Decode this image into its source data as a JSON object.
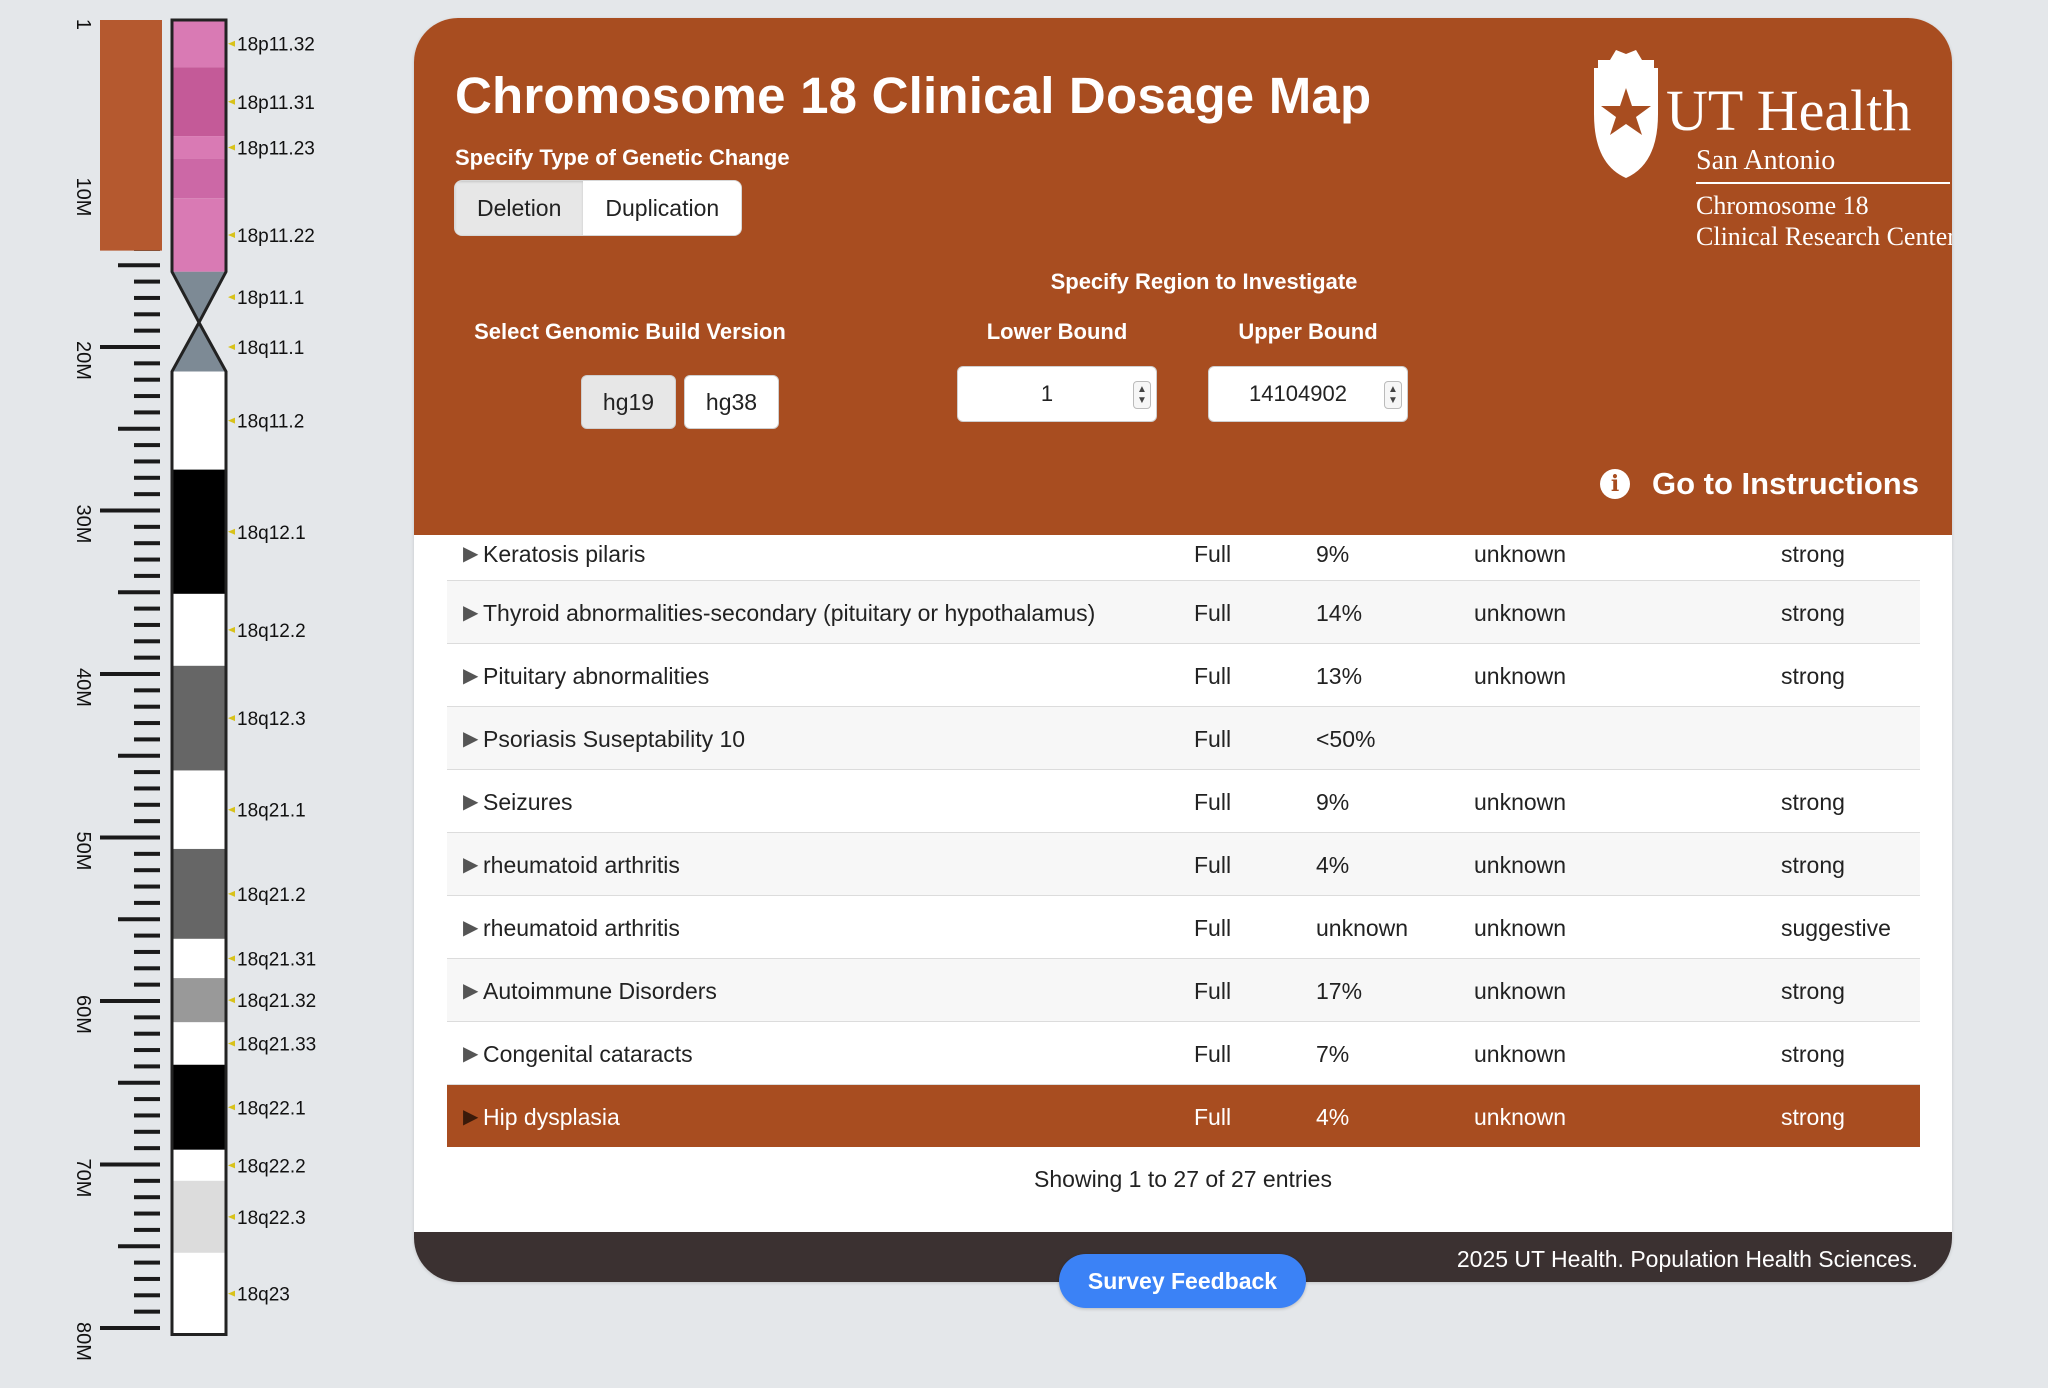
{
  "ideogram": {
    "scale_labels": [
      "1",
      "10M",
      "20M",
      "30M",
      "40M",
      "50M",
      "60M",
      "70M",
      "80M"
    ],
    "bands": [
      {
        "name": "18p11.32",
        "start": 0,
        "end": 2.9,
        "fill": "#d97ab4"
      },
      {
        "name": "18p11.31",
        "start": 2.9,
        "end": 7.1,
        "fill": "#c45a98"
      },
      {
        "name": "18p11.23",
        "start": 7.1,
        "end": 8.5,
        "fill": "#d97ab4"
      },
      {
        "name": "",
        "start": 8.5,
        "end": 10.9,
        "fill": "#cc68a6"
      },
      {
        "name": "18p11.22",
        "start": 10.9,
        "end": 15.4,
        "fill": "#d97ab4"
      },
      {
        "name": "18p11.1",
        "start": 15.4,
        "end": 18.5,
        "fill": "#7d8a95"
      },
      {
        "name": "18q11.1",
        "start": 18.5,
        "end": 21.5,
        "fill": "#7d8a95"
      },
      {
        "name": "18q11.2",
        "start": 21.5,
        "end": 27.5,
        "fill": "#ffffff"
      },
      {
        "name": "18q12.1",
        "start": 27.5,
        "end": 35.1,
        "fill": "#000000"
      },
      {
        "name": "18q12.2",
        "start": 35.1,
        "end": 39.5,
        "fill": "#ffffff"
      },
      {
        "name": "18q12.3",
        "start": 39.5,
        "end": 45.9,
        "fill": "#666666"
      },
      {
        "name": "18q21.1",
        "start": 45.9,
        "end": 50.7,
        "fill": "#ffffff"
      },
      {
        "name": "18q21.2",
        "start": 50.7,
        "end": 56.2,
        "fill": "#666666"
      },
      {
        "name": "18q21.31",
        "start": 56.2,
        "end": 58.6,
        "fill": "#ffffff"
      },
      {
        "name": "18q21.32",
        "start": 58.6,
        "end": 61.3,
        "fill": "#999999"
      },
      {
        "name": "18q21.33",
        "start": 61.3,
        "end": 63.9,
        "fill": "#ffffff"
      },
      {
        "name": "18q22.1",
        "start": 63.9,
        "end": 69.1,
        "fill": "#000000"
      },
      {
        "name": "18q22.2",
        "start": 69.1,
        "end": 71.0,
        "fill": "#ffffff"
      },
      {
        "name": "18q22.3",
        "start": 71.0,
        "end": 75.4,
        "fill": "#dcdcdc"
      },
      {
        "name": "18q23",
        "start": 75.4,
        "end": 80.4,
        "fill": "#ffffff"
      }
    ],
    "selection": {
      "start": 1,
      "end": 14104902
    },
    "colors": {
      "selection": "#b5592f",
      "marker": "#d8c21a"
    }
  },
  "header": {
    "title": "Chromosome 18 Clinical Dosage Map",
    "change_label": "Specify Type of Genetic Change",
    "deletion_label": "Deletion",
    "duplication_label": "Duplication",
    "region_label": "Specify Region to Investigate",
    "build_label": "Select Genomic Build Version",
    "hg19_label": "hg19",
    "hg38_label": "hg38",
    "lower_label": "Lower Bound",
    "upper_label": "Upper Bound",
    "lower_value": "1",
    "upper_value": "14104902",
    "instructions_label": "Go to Instructions",
    "logo": {
      "line1": "UT Health",
      "line2": "San Antonio",
      "line3": "Chromosome 18",
      "line4": "Clinical Research Center"
    }
  },
  "table": {
    "rows": [
      {
        "name": "Keratosis pilaris",
        "type": "Full",
        "pct": "9%",
        "col4": "unknown",
        "col5": "strong"
      },
      {
        "name": "Thyroid abnormalities-secondary (pituitary or hypothalamus)",
        "type": "Full",
        "pct": "14%",
        "col4": "unknown",
        "col5": "strong"
      },
      {
        "name": "Pituitary abnormalities",
        "type": "Full",
        "pct": "13%",
        "col4": "unknown",
        "col5": "strong"
      },
      {
        "name": "Psoriasis Suseptability 10",
        "type": "Full",
        "pct": "<50%",
        "col4": "",
        "col5": ""
      },
      {
        "name": "Seizures",
        "type": "Full",
        "pct": "9%",
        "col4": "unknown",
        "col5": "strong"
      },
      {
        "name": "rheumatoid arthritis",
        "type": "Full",
        "pct": "4%",
        "col4": "unknown",
        "col5": "strong"
      },
      {
        "name": "rheumatoid arthritis",
        "type": "Full",
        "pct": "unknown",
        "col4": "unknown",
        "col5": "suggestive"
      },
      {
        "name": "Autoimmune Disorders",
        "type": "Full",
        "pct": "17%",
        "col4": "unknown",
        "col5": "strong"
      },
      {
        "name": "Congenital cataracts",
        "type": "Full",
        "pct": "7%",
        "col4": "unknown",
        "col5": "strong"
      },
      {
        "name": "Hip dysplasia",
        "type": "Full",
        "pct": "4%",
        "col4": "unknown",
        "col5": "strong"
      }
    ],
    "arrow": "▶",
    "entries_text": "Showing 1 to 27 of 27 entries"
  },
  "footer": {
    "copyright": "2025 UT Health. Population Health Sciences.",
    "survey_label": "Survey Feedback"
  },
  "colors": {
    "brand": "#a84d20",
    "footer": "#3b3131",
    "survey": "#3b82f6"
  }
}
